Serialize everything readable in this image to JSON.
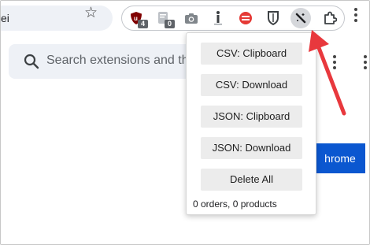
{
  "omnibox": {
    "text": "ei"
  },
  "extensions": [
    {
      "icon": "ublock-shield-icon",
      "badge": "4",
      "color": "#800000"
    },
    {
      "icon": "notes-icon",
      "badge": "0",
      "color": "#9aa0a6"
    },
    {
      "icon": "camera-icon",
      "color": "#70757a"
    },
    {
      "icon": "info-icon",
      "color": "#3c4043"
    },
    {
      "icon": "red-circle-icon",
      "color": "#e53935"
    },
    {
      "icon": "bitwarden-shield-icon",
      "color": "#3c4043"
    },
    {
      "icon": "magic-wand-icon",
      "active": true
    },
    {
      "icon": "puzzle-icon"
    }
  ],
  "search": {
    "placeholder": "Search extensions and th"
  },
  "main_button": {
    "label": "hrome"
  },
  "popup": {
    "buttons": [
      {
        "label": "CSV: Clipboard"
      },
      {
        "label": "CSV: Download"
      },
      {
        "label": "JSON: Clipboard"
      },
      {
        "label": "JSON: Download"
      },
      {
        "label": "Delete All"
      }
    ],
    "status": "0 orders, 0 products"
  },
  "annotation": {
    "arrow_color": "#e8383d"
  }
}
